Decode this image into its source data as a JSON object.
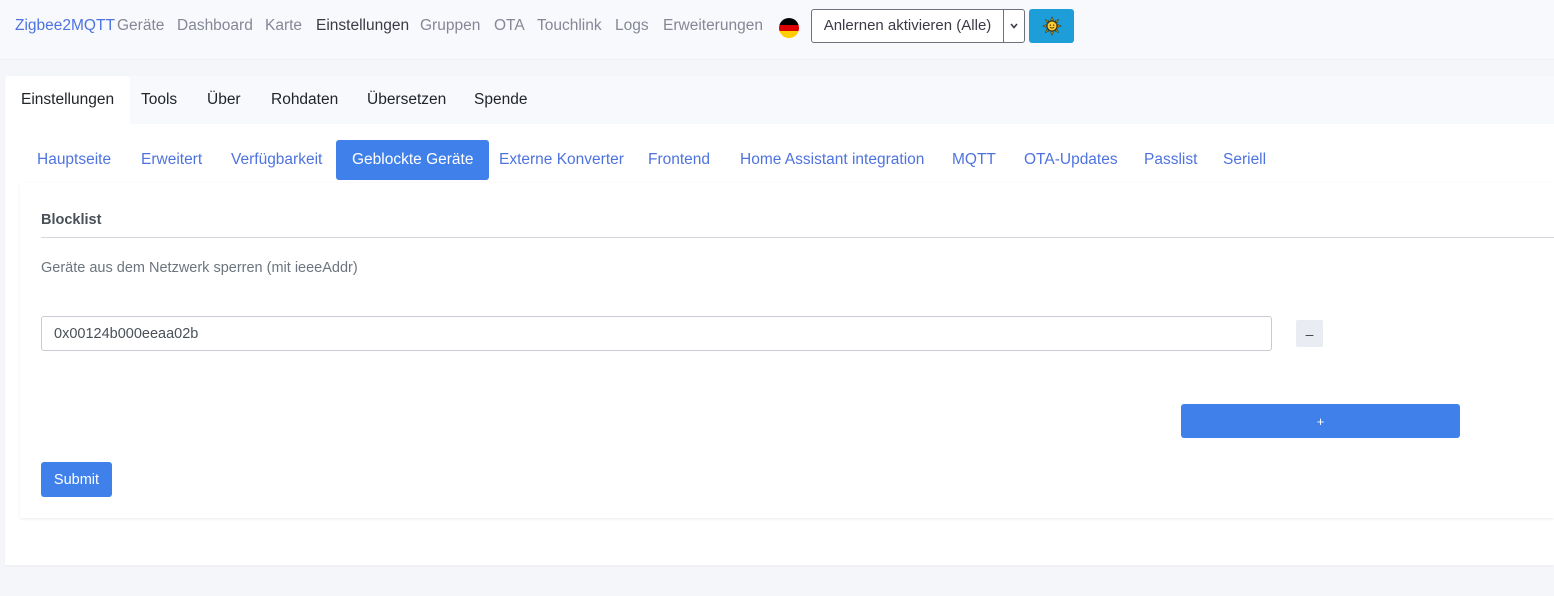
{
  "navbar": {
    "brand": "Zigbee2MQTT",
    "items": [
      {
        "label": "Geräte"
      },
      {
        "label": "Dashboard"
      },
      {
        "label": "Karte"
      },
      {
        "label": "Einstellungen",
        "active": true
      },
      {
        "label": "Gruppen"
      },
      {
        "label": "OTA"
      },
      {
        "label": "Touchlink"
      },
      {
        "label": "Logs"
      },
      {
        "label": "Erweiterungen"
      }
    ],
    "language_flag": "german-flag-icon",
    "join_select": {
      "value": "Anlernen aktivieren (Alle)"
    },
    "theme_icon": "sun-icon"
  },
  "tabs_top": [
    {
      "label": "Einstellungen",
      "active": true
    },
    {
      "label": "Tools"
    },
    {
      "label": "Über"
    },
    {
      "label": "Rohdaten"
    },
    {
      "label": "Übersetzen"
    },
    {
      "label": "Spende"
    }
  ],
  "tabs_sub": [
    {
      "label": "Hauptseite"
    },
    {
      "label": "Erweitert"
    },
    {
      "label": "Verfügbarkeit"
    },
    {
      "label": "Geblockte Geräte",
      "active": true
    },
    {
      "label": "Externe Konverter"
    },
    {
      "label": "Frontend"
    },
    {
      "label": "Home Assistant integration"
    },
    {
      "label": "MQTT"
    },
    {
      "label": "OTA-Updates"
    },
    {
      "label": "Passlist"
    },
    {
      "label": "Seriell"
    }
  ],
  "form": {
    "legend": "Blocklist",
    "description": "Geräte aus dem Netzwerk sperren (mit ieeeAddr)",
    "items": [
      {
        "value": "0x00124b000eeaa02b"
      }
    ],
    "remove_label": "–",
    "add_label": "+",
    "submit_label": "Submit"
  },
  "colors": {
    "primary": "#3f80ea",
    "link": "#4e73df",
    "theme_button": "#1e9ed9"
  }
}
